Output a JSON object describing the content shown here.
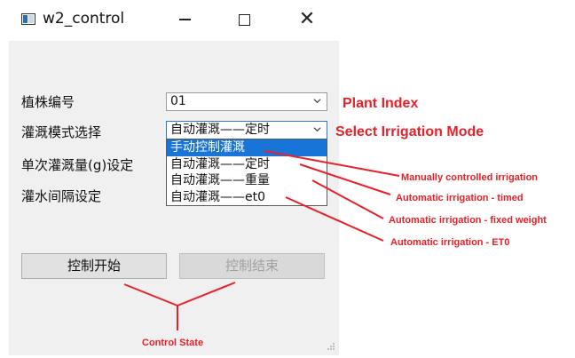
{
  "window": {
    "title": "w2_control"
  },
  "form": {
    "plant_index_label": "植株编号",
    "plant_index_value": "01",
    "mode_label": "灌溉模式选择",
    "mode_value": "自动灌溉——定时",
    "amount_label": "单次灌溉量(g)设定",
    "interval_label": "灌水间隔设定",
    "mode_options": [
      "手动控制灌溉",
      "自动灌溉——定时",
      "自动灌溉——重量",
      "自动灌溉——et0"
    ],
    "selected_option_index": 0
  },
  "buttons": {
    "start_label": "控制开始",
    "end_label": "控制结束"
  },
  "annotations": {
    "plant_index": "Plant Index",
    "select_mode": "Select Irrigation Mode",
    "manual": "Manually controlled irrigation",
    "timed": "Automatic irrigation - timed",
    "weight": "Automatic irrigation - fixed weight",
    "et0": "Automatic irrigation - ET0",
    "control_state": "Control State",
    "color": "#e8202a"
  }
}
